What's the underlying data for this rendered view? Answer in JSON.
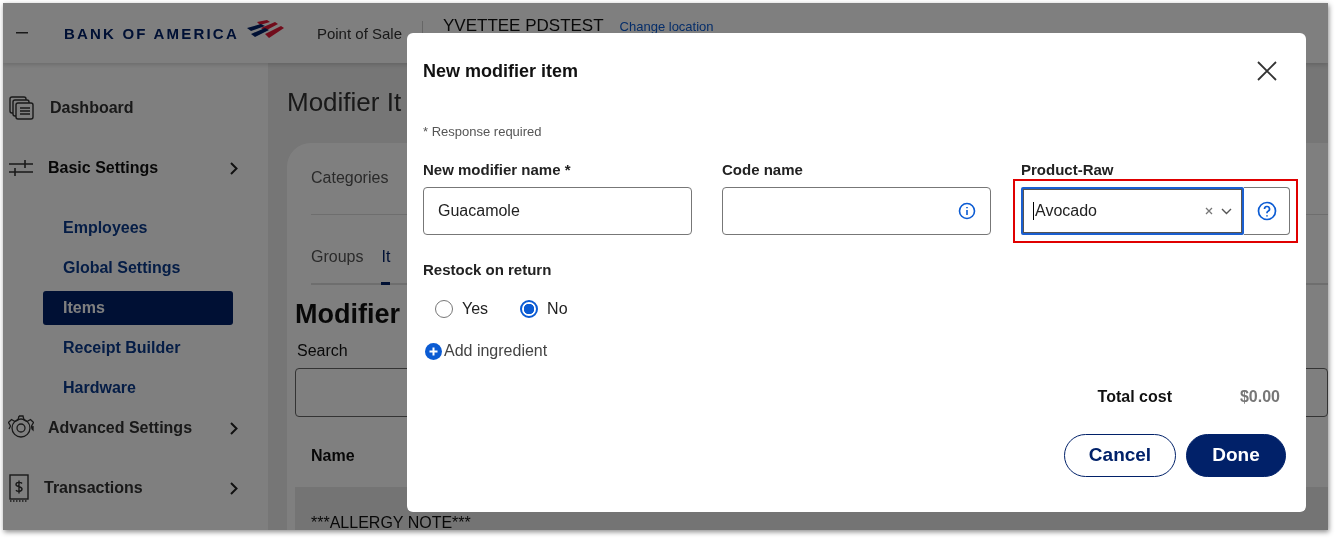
{
  "header": {
    "logo": "BANK OF AMERICA",
    "app_name": "Point of Sale",
    "location": "YVETTEE PDSTEST",
    "change_location": "Change location"
  },
  "sidebar": {
    "items": [
      {
        "label": "Dashboard",
        "expanded": false,
        "has_children": false
      },
      {
        "label": "Basic Settings",
        "expanded": true,
        "has_children": true,
        "children": [
          {
            "label": "Employees",
            "selected": false
          },
          {
            "label": "Global Settings",
            "selected": false
          },
          {
            "label": "Items",
            "selected": true
          },
          {
            "label": "Receipt Builder",
            "selected": false
          },
          {
            "label": "Hardware",
            "selected": false
          }
        ]
      },
      {
        "label": "Advanced Settings",
        "expanded": false,
        "has_children": true
      },
      {
        "label": "Transactions",
        "expanded": false,
        "has_children": true
      }
    ]
  },
  "page": {
    "title": "Modifier It",
    "top_tabs": [
      {
        "label": "Categories",
        "selected": false
      }
    ],
    "sub_tabs": [
      {
        "label": "Groups",
        "selected": false
      },
      {
        "label": "It",
        "selected": true
      }
    ],
    "section_title": "Modifier",
    "search_label": "Search",
    "table": {
      "columns": [
        "Name"
      ],
      "rows": [
        "***ALLERGY NOTE***"
      ]
    }
  },
  "modal": {
    "title": "New modifier item",
    "required_note": "* Response required",
    "fields": [
      {
        "kind": "text",
        "label": "New modifier name *",
        "value": "Guacamole"
      },
      {
        "kind": "info",
        "label": "Code name"
      },
      {
        "kind": "select",
        "label": "Product-Raw",
        "value": "Avocado",
        "highlighted": true
      }
    ],
    "restock": {
      "label": "Restock on return",
      "options": [
        {
          "label": "Yes",
          "selected": false
        },
        {
          "label": "No",
          "selected": true
        }
      ]
    },
    "add_ingredient": "Add ingredient",
    "total": {
      "label": "Total cost",
      "value": "$0.00"
    },
    "buttons": [
      {
        "label": "Cancel",
        "kind": "secondary"
      },
      {
        "label": "Done",
        "kind": "primary"
      }
    ]
  }
}
